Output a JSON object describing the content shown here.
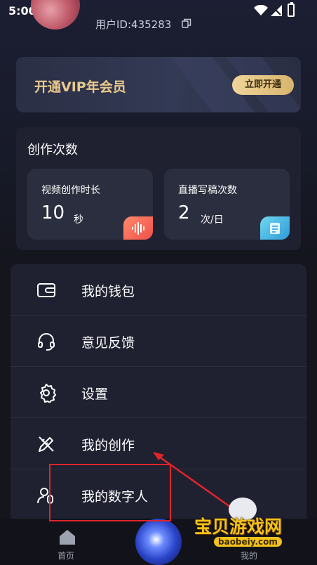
{
  "status": {
    "time": "5:00"
  },
  "user": {
    "id_text": "用户ID:435283"
  },
  "vip": {
    "title": "开通VIP年会员",
    "button": "立即开通"
  },
  "creation": {
    "title": "创作次数",
    "video": {
      "label": "视频创作时长",
      "value": "10",
      "unit": "秒"
    },
    "live": {
      "label": "直播写稿次数",
      "value": "2",
      "unit": "次/日"
    }
  },
  "menu": [
    {
      "label": "我的钱包",
      "icon": "wallet-icon"
    },
    {
      "label": "意见反馈",
      "icon": "headset-icon"
    },
    {
      "label": "设置",
      "icon": "gear-icon"
    },
    {
      "label": "我的创作",
      "icon": "pen-ruler-icon"
    },
    {
      "label": "我的数字人",
      "icon": "digital-human-icon"
    }
  ],
  "nav": {
    "home": "首页",
    "mine": "我的"
  },
  "watermark": {
    "name": "宝贝游戏网",
    "url": "baobeiy.com"
  },
  "colors": {
    "vip_gold": "#e9c98c",
    "highlight_red": "#e0242b",
    "watermark_yellow": "#f4c21b"
  }
}
